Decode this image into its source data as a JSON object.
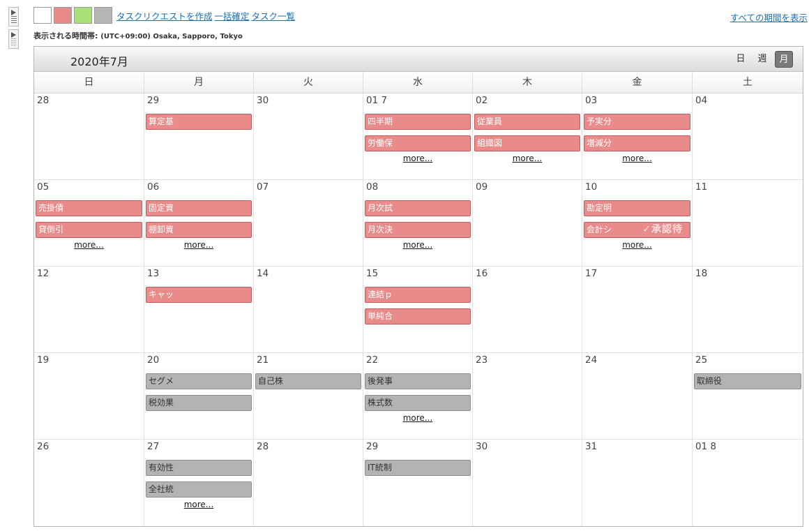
{
  "toolbar": {
    "swatch_colors": [
      "#ffffff",
      "#e88b8a",
      "#a8e07a",
      "#b5b5b5"
    ],
    "links": [
      "タスクリクエストを作成",
      "一括確定",
      "タスク一覧"
    ],
    "show_all": "すべての期間を表示"
  },
  "timezone": {
    "label": "表示される時間帯:",
    "value": "(UTC+09:00) Osaka, Sapporo, Tokyo"
  },
  "calendar": {
    "title": "2020年7月",
    "views": [
      "日",
      "週",
      "月"
    ],
    "active_view": "月",
    "weekdays": [
      "日",
      "月",
      "火",
      "水",
      "木",
      "金",
      "土"
    ],
    "more_label": "more...",
    "weeks": [
      [
        {
          "day": "28",
          "events": []
        },
        {
          "day": "29",
          "events": [
            {
              "title": "算定基",
              "color": "red"
            }
          ]
        },
        {
          "day": "30",
          "events": []
        },
        {
          "day": "01 7",
          "events": [
            {
              "title": "四半期",
              "color": "red"
            },
            {
              "title": "労働保",
              "color": "red"
            }
          ],
          "more": true
        },
        {
          "day": "02",
          "events": [
            {
              "title": "従業員",
              "color": "red"
            },
            {
              "title": "組織図",
              "color": "red"
            }
          ],
          "more": true
        },
        {
          "day": "03",
          "events": [
            {
              "title": "予実分",
              "color": "red"
            },
            {
              "title": "増減分",
              "color": "red"
            }
          ],
          "more": true
        },
        {
          "day": "04",
          "events": []
        }
      ],
      [
        {
          "day": "05",
          "events": [
            {
              "title": "売掛債",
              "color": "red"
            },
            {
              "title": "貸倒引",
              "color": "red"
            }
          ],
          "more": true
        },
        {
          "day": "06",
          "events": [
            {
              "title": "固定資",
              "color": "red"
            },
            {
              "title": "棚卸資",
              "color": "red"
            }
          ],
          "more": true
        },
        {
          "day": "07",
          "events": []
        },
        {
          "day": "08",
          "events": [
            {
              "title": "月次試",
              "color": "red"
            },
            {
              "title": "月次決",
              "color": "red"
            }
          ],
          "more": true
        },
        {
          "day": "09",
          "events": []
        },
        {
          "day": "10",
          "events": [
            {
              "title": "勘定明",
              "color": "red"
            },
            {
              "title": "会計シ",
              "color": "red",
              "badge": "✓承認待"
            }
          ],
          "more": true
        },
        {
          "day": "11",
          "events": []
        }
      ],
      [
        {
          "day": "12",
          "events": []
        },
        {
          "day": "13",
          "events": [
            {
              "title": "キャッ",
              "color": "red"
            }
          ]
        },
        {
          "day": "14",
          "events": []
        },
        {
          "day": "15",
          "events": [
            {
              "title": "連結ｐ",
              "color": "red"
            },
            {
              "title": "単純合",
              "color": "red"
            }
          ]
        },
        {
          "day": "16",
          "events": []
        },
        {
          "day": "17",
          "events": []
        },
        {
          "day": "18",
          "events": []
        }
      ],
      [
        {
          "day": "19",
          "events": []
        },
        {
          "day": "20",
          "events": [
            {
              "title": "セグメ",
              "color": "gray"
            },
            {
              "title": "税効果",
              "color": "gray"
            }
          ]
        },
        {
          "day": "21",
          "events": [
            {
              "title": "自己株",
              "color": "gray"
            }
          ]
        },
        {
          "day": "22",
          "events": [
            {
              "title": "後発事",
              "color": "gray"
            },
            {
              "title": "株式数",
              "color": "gray"
            }
          ],
          "more": true
        },
        {
          "day": "23",
          "events": []
        },
        {
          "day": "24",
          "events": []
        },
        {
          "day": "25",
          "events": [
            {
              "title": "取締役",
              "color": "gray"
            }
          ]
        }
      ],
      [
        {
          "day": "26",
          "events": []
        },
        {
          "day": "27",
          "events": [
            {
              "title": "有効性",
              "color": "gray"
            },
            {
              "title": "全社統",
              "color": "gray"
            }
          ],
          "more": true
        },
        {
          "day": "28",
          "events": []
        },
        {
          "day": "29",
          "events": [
            {
              "title": "IT統制",
              "color": "gray"
            }
          ]
        },
        {
          "day": "30",
          "events": []
        },
        {
          "day": "31",
          "events": []
        },
        {
          "day": "01 8",
          "events": []
        }
      ]
    ]
  }
}
